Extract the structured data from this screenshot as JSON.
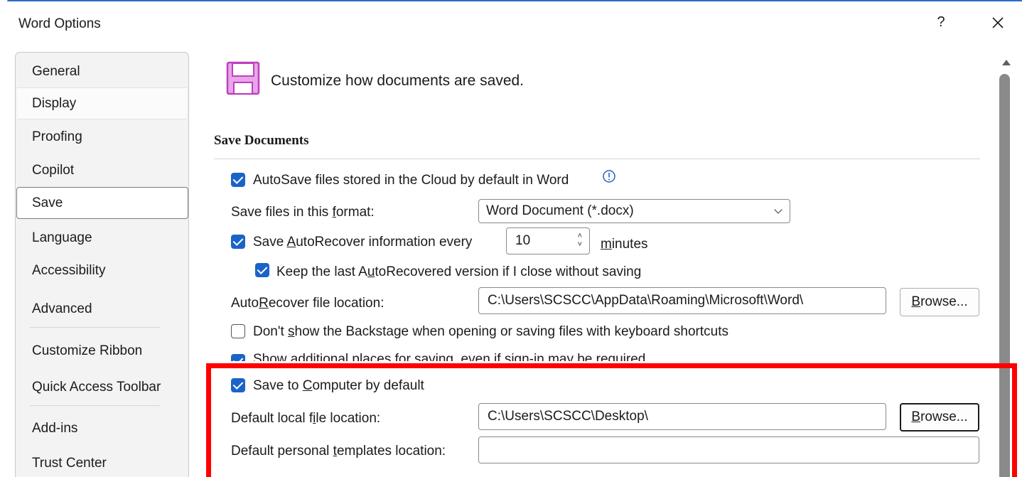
{
  "window": {
    "title": "Word Options",
    "help_label": "?",
    "close_icon": "close-icon"
  },
  "sidebar": {
    "items": [
      {
        "label": "General"
      },
      {
        "label": "Display"
      },
      {
        "label": "Proofing"
      },
      {
        "label": "Copilot"
      },
      {
        "label": "Save",
        "selected": true
      },
      {
        "label": "Language"
      },
      {
        "label": "Accessibility"
      },
      {
        "label": "Advanced"
      },
      {
        "label": "Customize Ribbon"
      },
      {
        "label": "Quick Access Toolbar"
      },
      {
        "label": "Add-ins"
      },
      {
        "label": "Trust Center"
      }
    ]
  },
  "main": {
    "headline": "Customize how documents are saved.",
    "section_title": "Save Documents",
    "autosave": {
      "label": "AutoSave files stored in the Cloud by default in Word",
      "checked": true
    },
    "format": {
      "label_pre": "Save files in this ",
      "label_u": "f",
      "label_post": "ormat:",
      "value": "Word Document (*.docx)"
    },
    "autorecover": {
      "pre": "Save ",
      "u": "A",
      "post": "utoRecover information every",
      "checked": true,
      "value": "10",
      "unit_u": "m",
      "unit_post": "inutes"
    },
    "keep_last": {
      "pre": "Keep the last A",
      "u": "u",
      "post": "toRecovered version if I close without saving",
      "checked": true
    },
    "autorecover_location": {
      "pre": "Auto",
      "u": "R",
      "post": "ecover file location:",
      "value": "C:\\Users\\SCSCC\\AppData\\Roaming\\Microsoft\\Word\\",
      "browse_u": "B",
      "browse_post": "rowse..."
    },
    "backstage": {
      "pre": "Don't ",
      "u": "s",
      "post": "how the Backstage when opening or saving files with keyboard shortcuts",
      "checked": false
    },
    "additional_places": {
      "label": "Show additional places for saving, even if sign-in may be required.",
      "checked": true
    },
    "save_to_computer": {
      "pre": "Save to ",
      "u": "C",
      "post": "omputer by default",
      "checked": true
    },
    "default_local": {
      "pre": "Default local f",
      "u": "i",
      "post": "le location:",
      "value": "C:\\Users\\SCSCC\\Desktop\\",
      "browse_u": "B",
      "browse_post": "rowse..."
    },
    "templates": {
      "pre": "Default personal ",
      "u": "t",
      "post": "emplates location:",
      "value": ""
    }
  },
  "colors": {
    "accent": "#1a64c8",
    "highlight": "#ff0000",
    "save_icon": "#c03fc0"
  }
}
